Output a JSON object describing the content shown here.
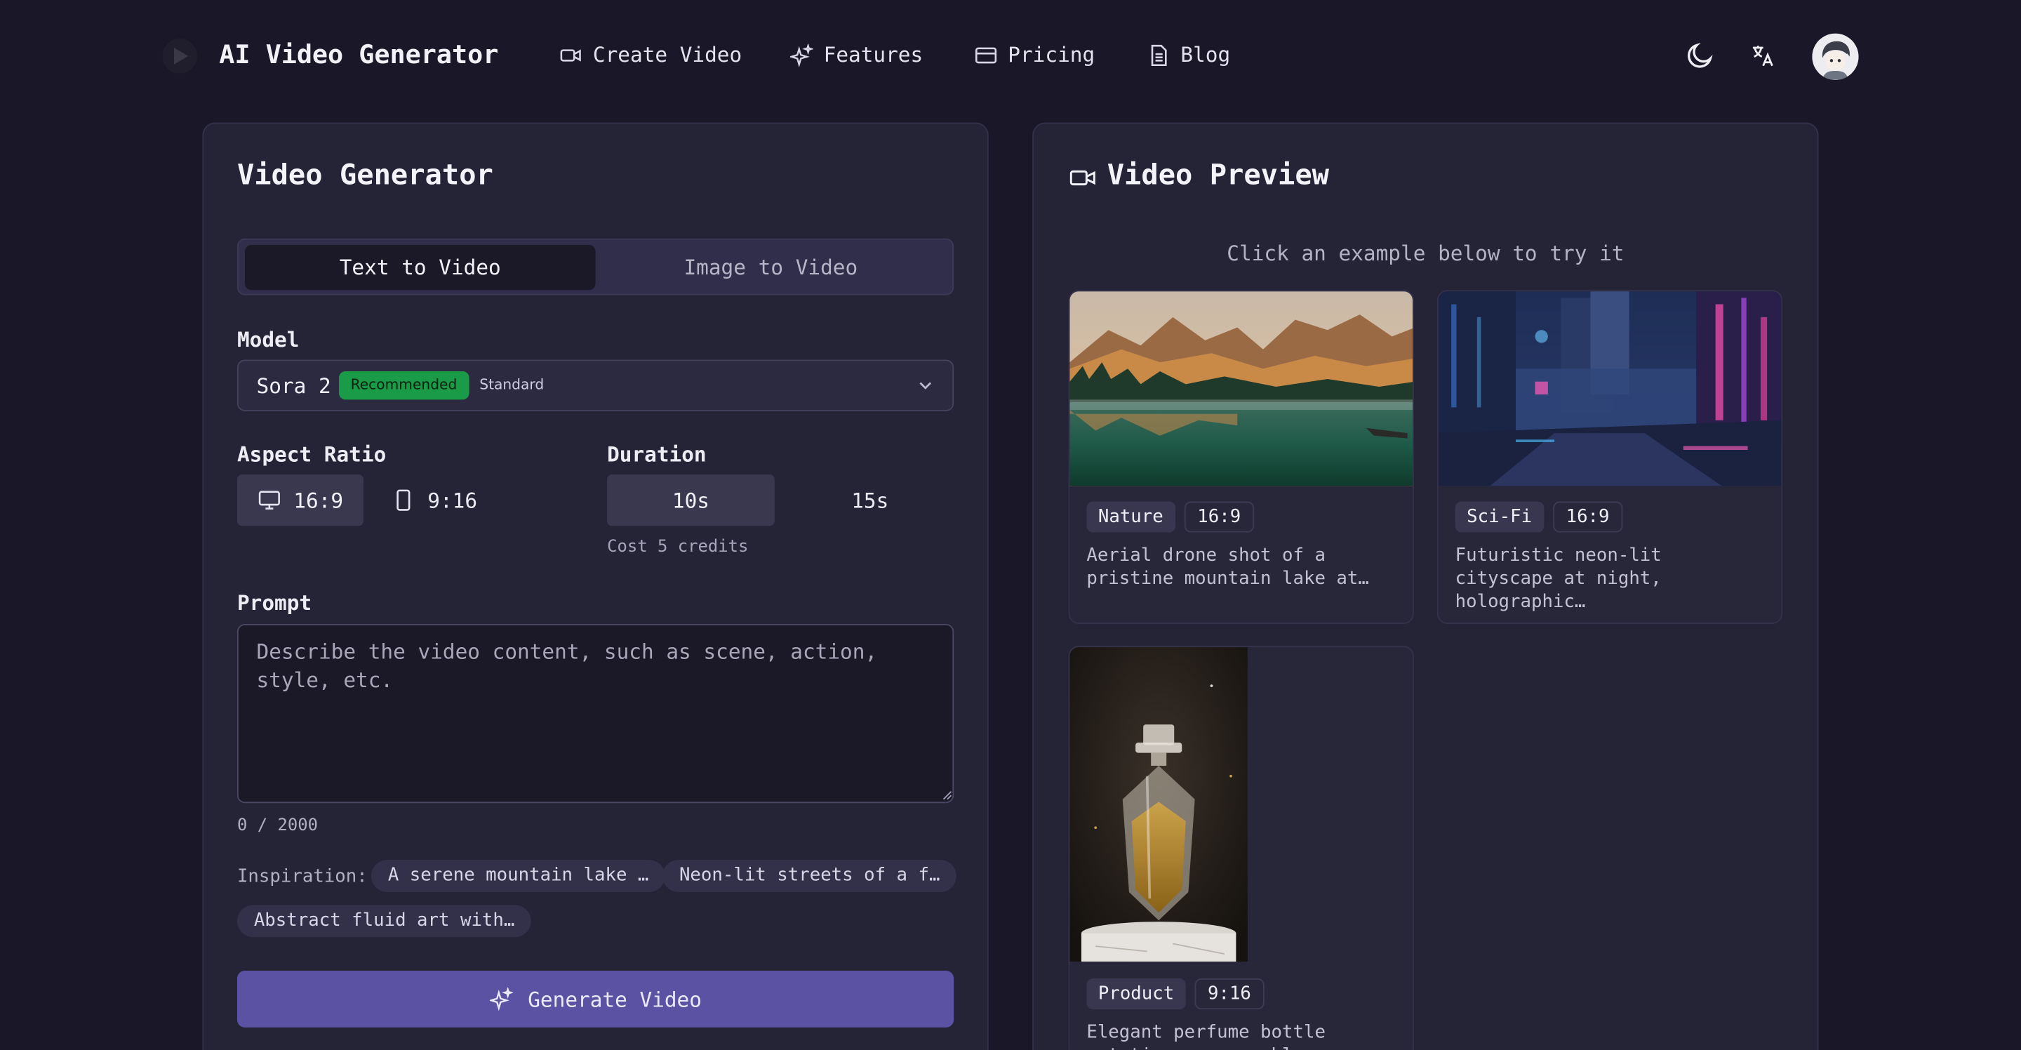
{
  "nav": {
    "brand": "AI Video Generator",
    "items": [
      {
        "label": "Create Video",
        "icon": "video-camera-icon"
      },
      {
        "label": "Features",
        "icon": "sparkles-icon"
      },
      {
        "label": "Pricing",
        "icon": "credit-card-icon"
      },
      {
        "label": "Blog",
        "icon": "document-icon"
      }
    ]
  },
  "generator": {
    "title": "Video Generator",
    "tabs": [
      {
        "label": "Text to Video",
        "active": true
      },
      {
        "label": "Image to Video",
        "active": false
      }
    ],
    "model_label": "Model",
    "model": {
      "name": "Sora 2",
      "badge": "Recommended",
      "tier": "Standard"
    },
    "aspect_label": "Aspect Ratio",
    "aspect_options": [
      {
        "label": "16:9",
        "selected": true
      },
      {
        "label": "9:16",
        "selected": false
      }
    ],
    "duration_label": "Duration",
    "duration_options": [
      {
        "label": "10s",
        "selected": true
      },
      {
        "label": "15s",
        "selected": false
      }
    ],
    "cost": "Cost 5 credits",
    "prompt_label": "Prompt",
    "prompt_placeholder": "Describe the video content, such as scene, action, style, etc.",
    "prompt_value": "",
    "counter": "0 / 2000",
    "inspiration_label": "Inspiration:",
    "inspirations": [
      "A serene mountain lake …",
      "Neon-lit streets of a f…",
      "Abstract fluid art with…"
    ],
    "generate_label": "Generate Video"
  },
  "preview": {
    "title": "Video Preview",
    "hint": "Click an example below to try it",
    "examples": [
      {
        "tag": "Nature",
        "ratio": "16:9",
        "desc": "Aerial drone shot of a pristine mountain lake at…"
      },
      {
        "tag": "Sci-Fi",
        "ratio": "16:9",
        "desc": "Futuristic neon-lit cityscape at night, holographic…"
      },
      {
        "tag": "Product",
        "ratio": "9:16",
        "desc": "Elegant perfume bottle rotating on a marble pedestal"
      }
    ]
  },
  "colors": {
    "background": "#1a1828",
    "card": "#252336",
    "accent": "#5c52a3",
    "recommended": "#1a9b48"
  }
}
